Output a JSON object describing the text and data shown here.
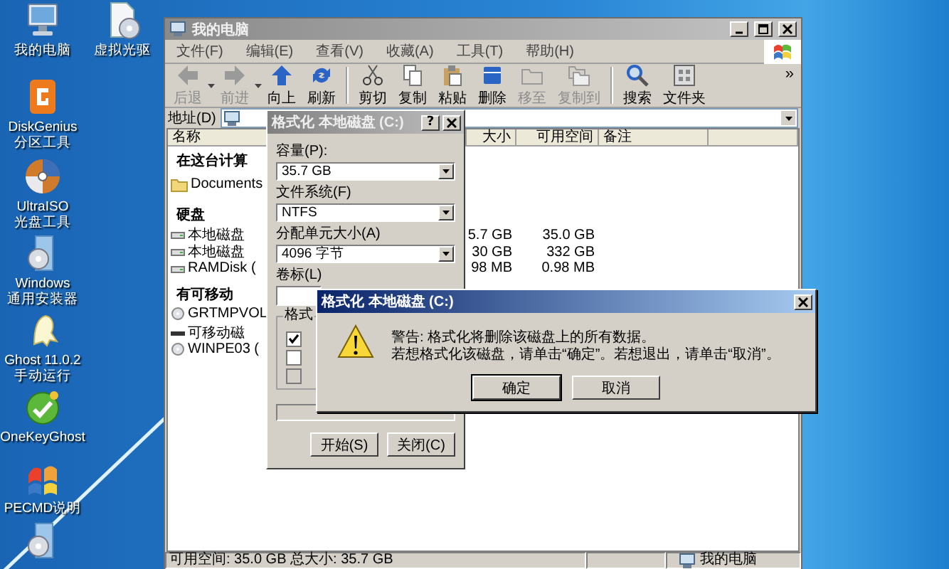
{
  "desktop": {
    "icons": [
      {
        "kind": "computer",
        "label": "我的电脑"
      },
      {
        "kind": "disc-drive",
        "label": "虚拟光驱"
      },
      {
        "kind": "tile",
        "label": "DiskGenius\n分区工具"
      },
      {
        "kind": "disc",
        "label": "UltraISO\n光盘工具"
      },
      {
        "kind": "installer",
        "label": "Windows\n通用安装器"
      },
      {
        "kind": "ghost",
        "label": "Ghost 11.0.2\n手动运行"
      },
      {
        "kind": "round-app",
        "label": "OneKeyGhost"
      },
      {
        "kind": "flag",
        "label": "PECMD说明"
      },
      {
        "kind": "installer"
      }
    ]
  },
  "explorer": {
    "title": "我的电脑",
    "menu": [
      "文件(F)",
      "编辑(E)",
      "查看(V)",
      "收藏(A)",
      "工具(T)",
      "帮助(H)"
    ],
    "toolbar": [
      {
        "kind": "back",
        "label": "后退",
        "disabled": true,
        "dropdown": true
      },
      {
        "kind": "forward",
        "label": "前进",
        "disabled": true,
        "dropdown": true
      },
      {
        "kind": "up",
        "label": "向上",
        "disabled": false,
        "dropdown": false
      },
      {
        "kind": "refresh",
        "label": "刷新",
        "disabled": false,
        "dropdown": false
      },
      {
        "kind": "separator"
      },
      {
        "kind": "cut",
        "label": "剪切",
        "disabled": false,
        "dropdown": false
      },
      {
        "kind": "copy",
        "label": "复制",
        "disabled": false,
        "dropdown": false
      },
      {
        "kind": "paste",
        "label": "粘贴",
        "disabled": false,
        "dropdown": false
      },
      {
        "kind": "delete",
        "label": "删除",
        "disabled": false,
        "dropdown": false
      },
      {
        "kind": "move",
        "label": "移至",
        "disabled": true,
        "dropdown": false
      },
      {
        "kind": "copy-to",
        "label": "复制到",
        "disabled": true,
        "dropdown": false
      },
      {
        "kind": "separator"
      },
      {
        "kind": "search",
        "label": "搜索",
        "disabled": false,
        "dropdown": false
      },
      {
        "kind": "folders",
        "label": "文件夹",
        "disabled": false,
        "dropdown": false
      }
    ],
    "toolbar_more": "»",
    "address_label": "地址(D)",
    "columns": [
      "名称",
      "大小",
      "可用空间",
      "备注"
    ],
    "items": [
      {
        "kind": "group",
        "name": "在这台计算"
      },
      {
        "kind": "folder",
        "name": "Documents"
      },
      {
        "kind": "group",
        "name": "硬盘"
      },
      {
        "kind": "drive",
        "name": "本地磁盘",
        "total": "5.7 GB",
        "free": "35.0 GB"
      },
      {
        "kind": "drive",
        "name": "本地磁盘",
        "total": "30 GB",
        "free": "332 GB"
      },
      {
        "kind": "drive",
        "name": "RAMDisk (",
        "total": "98 MB",
        "free": "0.98 MB"
      },
      {
        "kind": "group",
        "name": "有可移动"
      },
      {
        "kind": "cd",
        "name": "GRTMPVOL"
      },
      {
        "kind": "usb",
        "name": "可移动磁"
      },
      {
        "kind": "cd",
        "name": "WINPE03 ("
      }
    ],
    "status": {
      "summary": "可用空间: 35.0 GB 总大小: 35.7 GB",
      "location": "我的电脑"
    }
  },
  "format_dialog": {
    "title": "格式化 本地磁盘 (C:)",
    "help": "?",
    "fields": [
      {
        "kind": "combo",
        "label": "容量(P):",
        "value": "35.7 GB"
      },
      {
        "kind": "combo",
        "label": "文件系统(F)",
        "value": "NTFS"
      },
      {
        "kind": "combo",
        "label": "分配单元大小(A)",
        "value": "4096 字节"
      },
      {
        "kind": "text",
        "label": "卷标(L)"
      }
    ],
    "options_legend": "格式",
    "options": [
      {
        "checked": true,
        "disabled": false
      },
      {
        "checked": false,
        "disabled": false
      },
      {
        "checked": false,
        "disabled": true
      }
    ],
    "progress": {
      "level": 0
    },
    "buttons": [
      "开始(S)",
      "关闭(C)"
    ]
  },
  "msgbox": {
    "title": "格式化 本地磁盘 (C:)",
    "lines": [
      "警告: 格式化将删除该磁盘上的所有数据。",
      "若想格式化该磁盘，请单击“确定”。若想退出，请单击“取消”。"
    ],
    "buttons": [
      {
        "label": "确定",
        "selected": true
      },
      {
        "label": "取消",
        "selected": false
      }
    ]
  }
}
